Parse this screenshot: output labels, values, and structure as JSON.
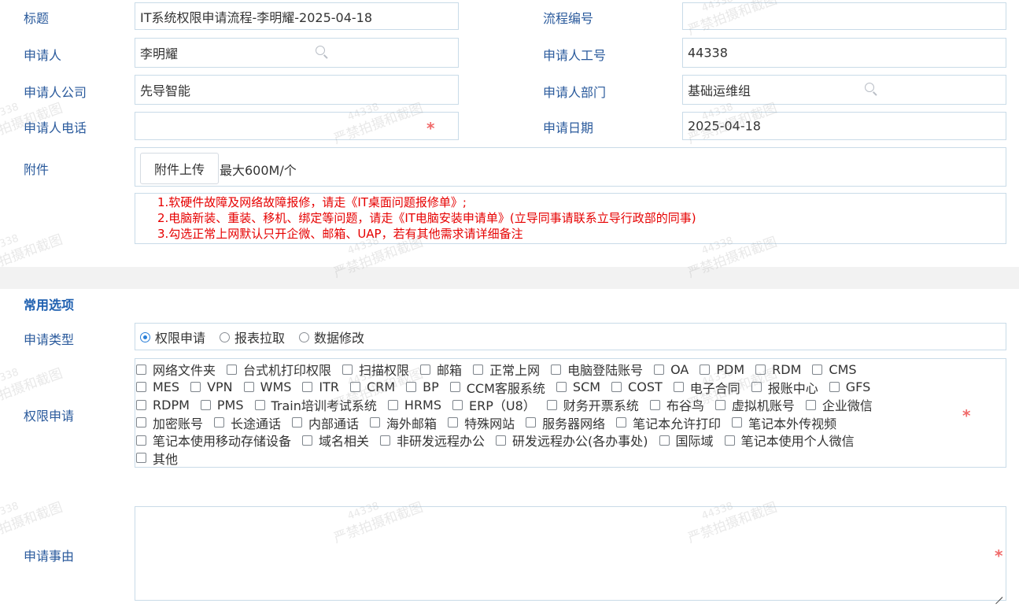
{
  "form": {
    "title": {
      "label": "标题",
      "value": "IT系统权限申请流程-李明耀-2025-04-18"
    },
    "flow_no": {
      "label": "流程编号",
      "value": ""
    },
    "applicant": {
      "label": "申请人",
      "value": "李明耀"
    },
    "employee_id": {
      "label": "申请人工号",
      "value": "44338"
    },
    "company": {
      "label": "申请人公司",
      "value": "先导智能"
    },
    "department": {
      "label": "申请人部门",
      "value": "基础运维组"
    },
    "phone": {
      "label": "申请人电话",
      "value": ""
    },
    "date": {
      "label": "申请日期",
      "value": "2025-04-18"
    },
    "attachment": {
      "label": "附件",
      "button": "附件上传",
      "hint": "最大600M/个"
    },
    "notes": [
      "1.软硬件故障及网络故障报修，请走《IT桌面问题报修单》;",
      "2.电脑新装、重装、移机、绑定等问题，请走《IT电脑安装申请单》(立导同事请联系立导行政部的同事)",
      "3.勾选正常上网默认只开企微、邮箱、UAP，若有其他需求请详细备注"
    ],
    "required_mark": "*"
  },
  "common": {
    "section_title": "常用选项",
    "apply_type": {
      "label": "申请类型",
      "options": [
        "权限申请",
        "报表拉取",
        "数据修改"
      ],
      "selected": 0
    },
    "permissions": {
      "label": "权限申请",
      "rows": [
        [
          "网络文件夹",
          "台式机打印权限",
          "扫描权限",
          "邮箱",
          "正常上网",
          "电脑登陆账号",
          "OA",
          "PDM",
          "RDM",
          "CMS"
        ],
        [
          "MES",
          "VPN",
          "WMS",
          "ITR",
          "CRM",
          "BP",
          "CCM客服系统",
          "SCM",
          "COST",
          "电子合同",
          "报账中心",
          "GFS"
        ],
        [
          "RDPM",
          "PMS",
          "Train培训考试系统",
          "HRMS",
          "ERP（U8）",
          "财务开票系统",
          "布谷鸟",
          "虚拟机账号",
          "企业微信"
        ],
        [
          "加密账号",
          "长途通话",
          "内部通话",
          "海外邮箱",
          "特殊网站",
          "服务器网络",
          "笔记本允许打印",
          "笔记本外传视频"
        ],
        [
          "笔记本使用移动存储设备",
          "域名相关",
          "非研发远程办公",
          "研发远程办公(各办事处)",
          "国际域",
          "笔记本使用个人微信"
        ],
        [
          "其他"
        ]
      ]
    },
    "reason": {
      "label": "申请事由",
      "value": ""
    }
  },
  "watermark": {
    "number": "44338",
    "text": "严禁拍摄和截图"
  },
  "colors": {
    "label": "#2a5a9c",
    "section": "#1f60b0",
    "required": "#f06a6a",
    "note": "#e60000",
    "border": "#c9dbe8"
  }
}
